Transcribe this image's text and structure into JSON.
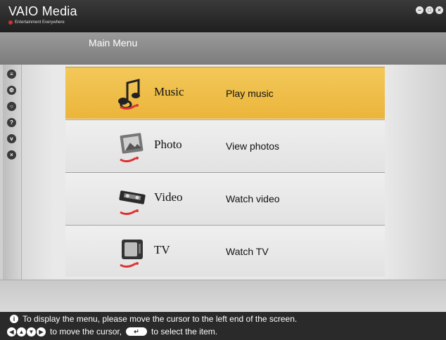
{
  "app": {
    "title": "VAIO Media",
    "tagline": "Entertainment Everywhere",
    "window_controls": [
      "minimize-icon",
      "restore-icon",
      "close-icon"
    ]
  },
  "section": {
    "title": "Main Menu"
  },
  "left_rail": {
    "icons": [
      "menu-icon",
      "settings-icon",
      "record-icon",
      "help-icon",
      "vaio-icon",
      "close-icon"
    ]
  },
  "menu": {
    "items": [
      {
        "label": "Music",
        "description": "Play music",
        "icon": "music-note-icon",
        "selected": true
      },
      {
        "label": "Photo",
        "description": "View photos",
        "icon": "photo-frame-icon",
        "selected": false
      },
      {
        "label": "Video",
        "description": "Watch video",
        "icon": "video-tape-icon",
        "selected": false
      },
      {
        "label": "TV",
        "description": "Watch TV",
        "icon": "tv-icon",
        "selected": false
      }
    ]
  },
  "help": {
    "line1": "To display the menu, please move the cursor to the left end of the screen.",
    "line2_a": "to move the cursor,",
    "line2_b": "to select the item."
  },
  "colors": {
    "selected_item": "#f0c050",
    "titlebar": "#262626",
    "section_bar": "#8a8a8a",
    "help_bar": "#2a2a2a"
  }
}
